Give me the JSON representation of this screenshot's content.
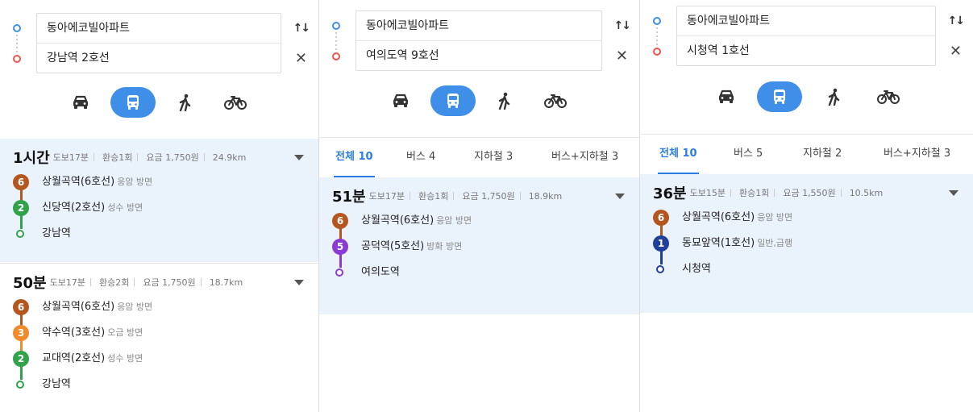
{
  "colors": {
    "accent": "#3f8fe8",
    "tab_active": "#2a7de1",
    "start_marker": "#3f8fe8",
    "end_marker": "#f0554d",
    "line6": "#b5561e",
    "line2": "#2fa24a",
    "line3": "#f08a2a",
    "line5": "#8a3bd6",
    "line1": "#1f3f9a",
    "selected_bg": "#eaf3fc"
  },
  "panels": [
    {
      "origin": "동아에코빌아파트",
      "destination": "강남역 2호선",
      "modes": [
        {
          "icon": "car-icon",
          "active": false
        },
        {
          "icon": "bus-icon",
          "active": true
        },
        {
          "icon": "walk-icon",
          "active": false
        },
        {
          "icon": "bike-icon",
          "active": false
        }
      ],
      "routes": [
        {
          "duration": "1시간",
          "walk": "도보17분",
          "transfer": "환승1회",
          "fare": "요금 1,750원",
          "distance": "24.9km",
          "selected": true,
          "stops": [
            {
              "badge": "6",
              "color": "#b5561e",
              "name": "상월곡역(6호선)",
              "dir": "응암 방면"
            },
            {
              "badge": "2",
              "color": "#2fa24a",
              "name": "신당역(2호선)",
              "dir": "성수 방면"
            },
            {
              "badge": "",
              "color": "#2fa24a",
              "name": "강남역",
              "dir": ""
            }
          ]
        },
        {
          "duration": "50분",
          "walk": "도보17분",
          "transfer": "환승2회",
          "fare": "요금 1,750원",
          "distance": "18.7km",
          "selected": false,
          "stops": [
            {
              "badge": "6",
              "color": "#b5561e",
              "name": "상월곡역(6호선)",
              "dir": "응암 방면"
            },
            {
              "badge": "3",
              "color": "#f08a2a",
              "name": "약수역(3호선)",
              "dir": "오금 방면"
            },
            {
              "badge": "2",
              "color": "#2fa24a",
              "name": "교대역(2호선)",
              "dir": "성수 방면"
            },
            {
              "badge": "",
              "color": "#2fa24a",
              "name": "강남역",
              "dir": ""
            }
          ]
        }
      ]
    },
    {
      "origin": "동아에코빌아파트",
      "destination": "여의도역 9호선",
      "modes": [
        {
          "icon": "car-icon",
          "active": false
        },
        {
          "icon": "bus-icon",
          "active": true
        },
        {
          "icon": "walk-icon",
          "active": false
        },
        {
          "icon": "bike-icon",
          "active": false
        }
      ],
      "tabs": [
        "전체 10",
        "버스 4",
        "지하철 3",
        "버스+지하철 3"
      ],
      "routes": [
        {
          "duration": "51분",
          "walk": "도보17분",
          "transfer": "환승1회",
          "fare": "요금 1,750원",
          "distance": "18.9km",
          "selected": true,
          "stops": [
            {
              "badge": "6",
              "color": "#b5561e",
              "name": "상월곡역(6호선)",
              "dir": "응암 방면"
            },
            {
              "badge": "5",
              "color": "#8a3bd6",
              "name": "공덕역(5호선)",
              "dir": "방화 방면"
            },
            {
              "badge": "",
              "color": "#8a3bd6",
              "name": "여의도역",
              "dir": ""
            }
          ]
        }
      ]
    },
    {
      "origin": "동아에코빌아파트",
      "destination": "시청역 1호선",
      "modes": [
        {
          "icon": "car-icon",
          "active": false
        },
        {
          "icon": "bus-icon",
          "active": true
        },
        {
          "icon": "walk-icon",
          "active": false
        },
        {
          "icon": "bike-icon",
          "active": false
        }
      ],
      "tabs": [
        "전체 10",
        "버스 5",
        "지하철 2",
        "버스+지하철 3"
      ],
      "routes": [
        {
          "duration": "36분",
          "walk": "도보15분",
          "transfer": "환승1회",
          "fare": "요금 1,550원",
          "distance": "10.5km",
          "selected": true,
          "stops": [
            {
              "badge": "6",
              "color": "#b5561e",
              "name": "상월곡역(6호선)",
              "dir": "응암 방면"
            },
            {
              "badge": "1",
              "color": "#1f3f9a",
              "name": "동묘앞역(1호선)",
              "dir": "일반,급행"
            },
            {
              "badge": "",
              "color": "#1f3f9a",
              "name": "시청역",
              "dir": ""
            }
          ]
        }
      ]
    }
  ]
}
